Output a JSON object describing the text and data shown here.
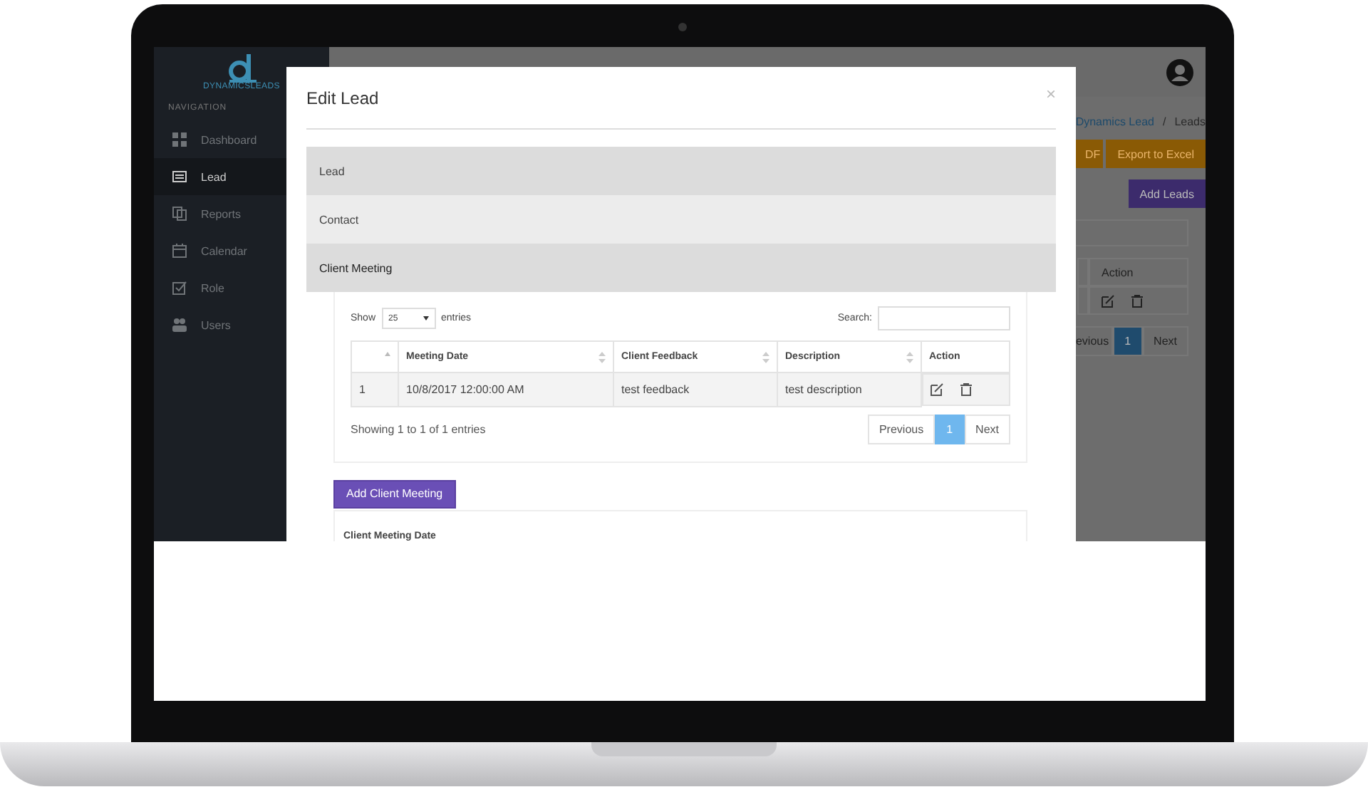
{
  "sidebar": {
    "logo_text": "DYNAMICSLEADS",
    "section_label": "NAVIGATION",
    "items": [
      {
        "label": "Dashboard",
        "selected": false
      },
      {
        "label": "Lead",
        "selected": true
      },
      {
        "label": "Reports",
        "selected": false
      },
      {
        "label": "Calendar",
        "selected": false
      },
      {
        "label": "Role",
        "selected": false
      },
      {
        "label": "Users",
        "selected": false
      }
    ]
  },
  "background_page": {
    "breadcrumb": [
      "Dynamics Lead",
      "Leads"
    ],
    "breadcrumb_separator": "/",
    "export_buttons": [
      "DF",
      "Export to Excel"
    ],
    "add_button": "Add Leads",
    "table_header": "Action",
    "pagination": {
      "previous": "evious",
      "page": "1",
      "next": "Next"
    }
  },
  "modal": {
    "title": "Edit Lead",
    "close": "×",
    "sections": [
      {
        "label": "Lead",
        "expanded": false
      },
      {
        "label": "Contact",
        "expanded": false
      },
      {
        "label": "Client Meeting",
        "expanded": true
      }
    ],
    "meetings": {
      "show_label": "Show",
      "page_size": "25",
      "entries_label": "entries",
      "search_label": "Search:",
      "columns": [
        "",
        "Meeting Date",
        "Client Feedback",
        "Description",
        "Action"
      ],
      "rows": [
        [
          "1",
          "10/8/2017 12:00:00 AM",
          "test feedback",
          "test description"
        ]
      ],
      "summary": "Showing 1 to 1 of 1 entries",
      "pagination": {
        "previous": "Previous",
        "pages": [
          {
            "label": "1",
            "selected": true
          }
        ],
        "next": "Next"
      }
    },
    "add_button": "Add Client Meeting",
    "form_label": "Client Meeting Date"
  }
}
